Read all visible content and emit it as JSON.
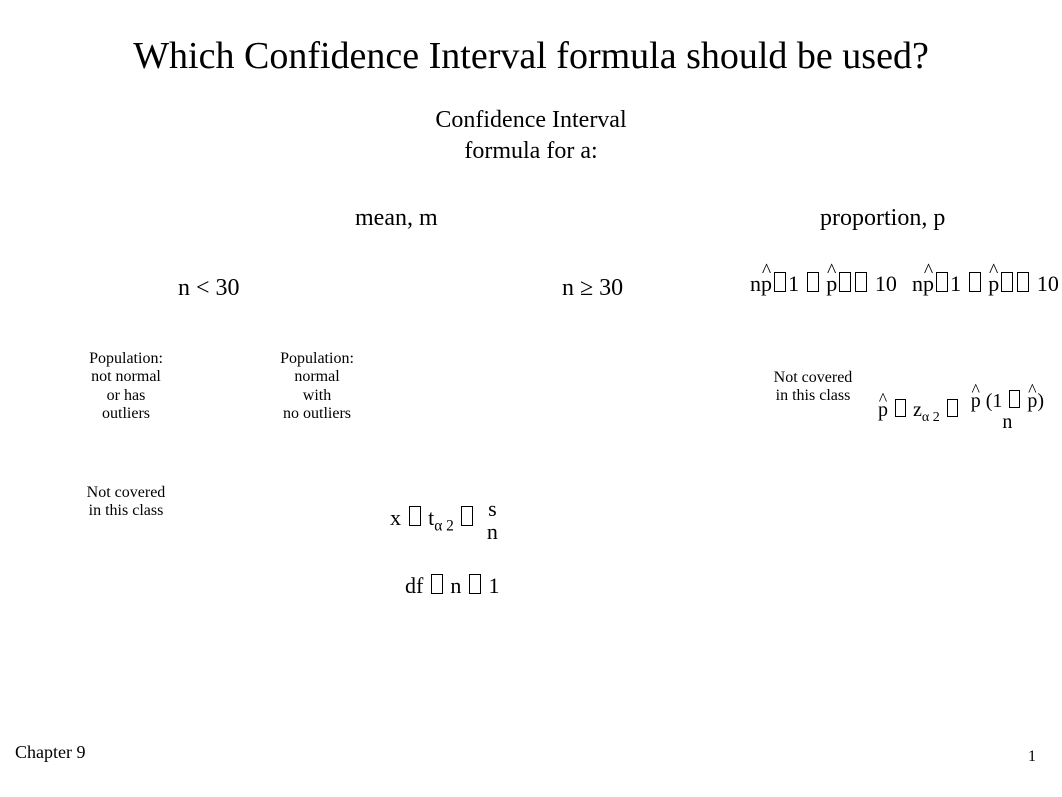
{
  "title": "Which Confidence Interval formula should be used?",
  "subhead_line1": "Confidence Interval",
  "subhead_line2": "formula for a:",
  "branches": {
    "mean_label": "mean,  m",
    "proportion_label": "proportion,  p"
  },
  "mean": {
    "n_lt_30": "n < 30",
    "n_ge_30": "n ≥ 30",
    "pop_not_normal": {
      "l1": "Population:",
      "l2": "not normal",
      "l3": "or has",
      "l4": "outliers"
    },
    "pop_normal": {
      "l1": "Population:",
      "l2": "normal",
      "l3": "with",
      "l4": "no outliers"
    },
    "not_covered": {
      "l1": "Not covered",
      "l2": "in this class"
    },
    "t_formula": {
      "x": "x",
      "t": "t",
      "alpha2": "α 2",
      "s": "s",
      "n": "n"
    },
    "df_formula": {
      "df": "df",
      "n": "n",
      "one": "1"
    }
  },
  "proportion": {
    "np_lt_10": {
      "n": "n",
      "p": "p",
      "one": "1",
      "ten": "10"
    },
    "np_ge_10": {
      "n": "n",
      "p": "p",
      "one": "1",
      "ten": "10"
    },
    "not_covered": {
      "l1": "Not covered",
      "l2": "in this class"
    },
    "z_formula": {
      "p": "p",
      "z": "z",
      "alpha2": "α 2",
      "one": "1",
      "n": "n"
    }
  },
  "footer": {
    "chapter": "Chapter 9",
    "page": "1"
  }
}
